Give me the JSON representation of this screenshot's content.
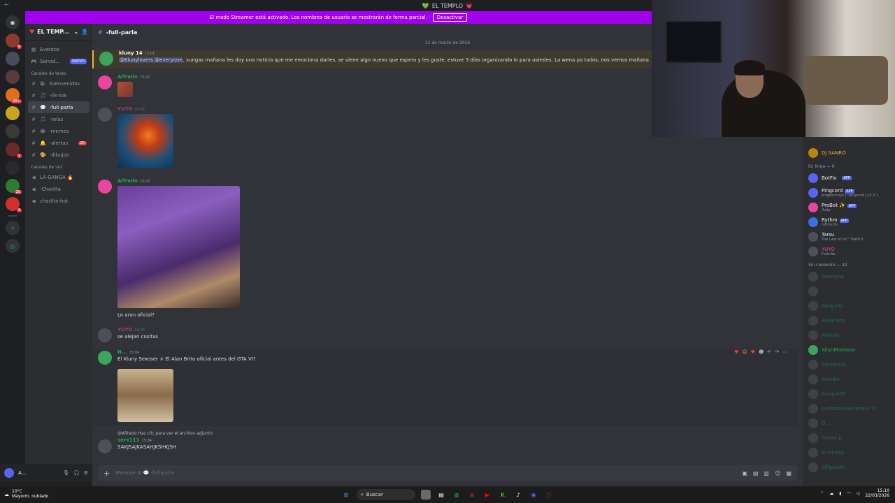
{
  "window": {
    "title_left": "💚",
    "title": "EL TEMPLO",
    "title_right": "💗"
  },
  "banner": {
    "text": "El modo Streamer está activado. Los nombres de usuario se mostrarán de forma parcial.",
    "button": "Desactivar"
  },
  "rail": {
    "badges": [
      "9",
      "99+",
      "1",
      "20",
      "4"
    ]
  },
  "sidebar": {
    "server_name": "EL TEMP...",
    "events": "Eventos",
    "server_item": "Servid...",
    "new_badge": "NUEVO",
    "text_category": "Canales de texto",
    "text_channels": [
      {
        "name": "-bienvenidos",
        "emoji": "😀"
      },
      {
        "name": "-tik-tok",
        "emoji": "🎵"
      },
      {
        "name": "-full-parla",
        "emoji": "💬"
      },
      {
        "name": "-rolas",
        "emoji": "🎵"
      },
      {
        "name": "-memes",
        "emoji": "😂"
      },
      {
        "name": "-alertas",
        "emoji": "🔔",
        "count": "20"
      },
      {
        "name": "-dibujos",
        "emoji": "🎨"
      }
    ],
    "voice_category": "Canales de voz",
    "voice_channels": [
      "LA GANGA 🔥",
      "-Charlita",
      "charlita-hot"
    ]
  },
  "user_panel": {
    "name": "A..."
  },
  "main": {
    "channel": "-full-parla",
    "date": "22 de marzo de 2026",
    "messages": [
      {
        "author": "kluny 14",
        "time": "15:01",
        "mention": "@Klunylovers @everyone",
        "text": ", sungas mañana les doy una noticia que me emociona darles, se viene algo nuevo que espero y les guste, estuve 3 días organizando lo para ustedes. La wena pa todos, nos vemos mañana"
      },
      {
        "author": "Alfredo",
        "time": "15:02"
      },
      {
        "author": "YUYO",
        "time": "15:02"
      },
      {
        "author": "Alfredo",
        "time": "15:03",
        "text": "Lo aran oficial?"
      },
      {
        "author": "YUYO",
        "time": "15:03",
        "text": "se alejan cositas"
      },
      {
        "author": "N...",
        "time": "15:04",
        "text": "El Kluny Sexoser × El Alan Brito oficial antes del GTA VI?"
      },
      {
        "author": "serx111",
        "time": "15:04",
        "reply": "@Alfredo Haz clic para ver el archivo adjunto",
        "text": "SAKJSAJKASAHJKSHKJSH"
      }
    ],
    "input_placeholder": "Mensaje # 💬 -full-parla"
  },
  "members": {
    "top_name": "DJ SANRO",
    "online_header": "En línea — 6",
    "online": [
      {
        "name": "BotFix",
        "app": "APP"
      },
      {
        "name": "Pingcord",
        "app": "APP",
        "sub": "pingcord.xyz | !pingcord | v2.2.1"
      },
      {
        "name": "ProBot ✨",
        "app": "APP",
        "sub": "/help"
      },
      {
        "name": "Rythm",
        "app": "APP",
        "sub": "rythm.fm"
      },
      {
        "name": "Tarsu",
        "sub": "The Last of Us™ Parte II"
      },
      {
        "name": "YUYO",
        "sub": "Fortnite"
      }
    ],
    "offline_header": "Sin conexión — 42",
    "offline": [
      "Georgina",
      "",
      "Abugado",
      "alejandro",
      "Alfredo",
      "AllanMontana",
      "AmyBlack",
      "arcadio",
      "basquetO",
      "bobtoronjaestanga777",
      "D...",
      "Dyllan jr",
      "El Mickey",
      "Elfiguado"
    ]
  },
  "taskbar": {
    "temp": "10°C",
    "weather": "Mayorm. nublado",
    "search": "Buscar",
    "time": "15:10",
    "date": "22/03/2026"
  },
  "colors": {
    "accent": "#5865f2",
    "banner": "#a100ef",
    "online_green": "#23a55a",
    "alert_red": "#f23f43"
  }
}
